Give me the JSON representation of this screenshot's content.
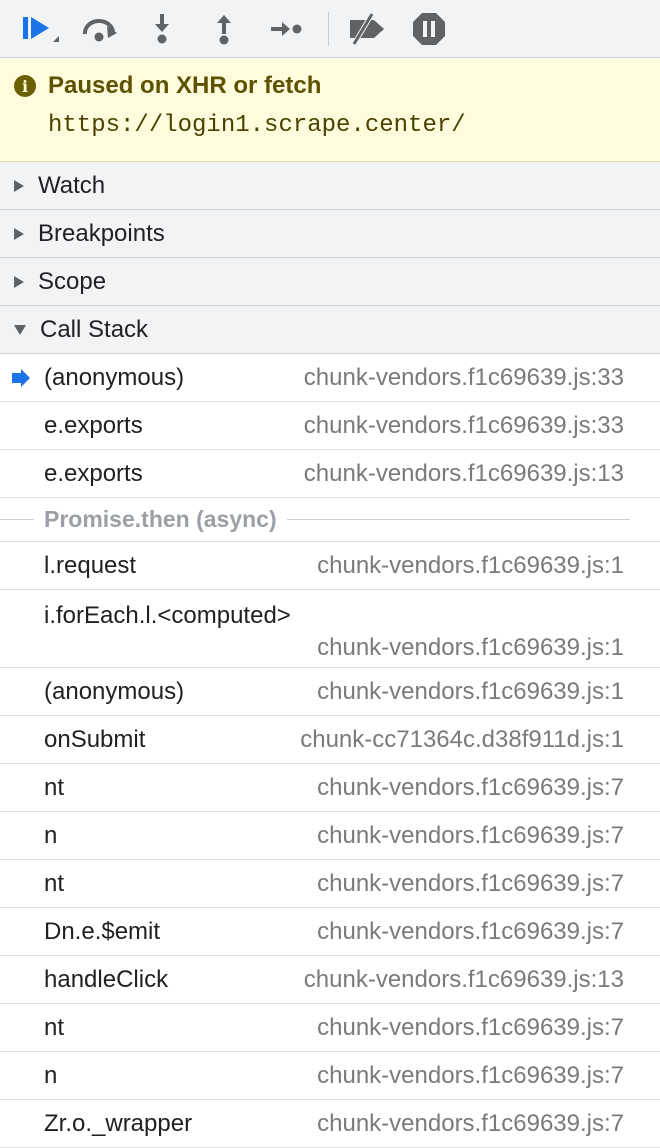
{
  "toolbar": {
    "icons": [
      "resume-icon",
      "step-over-icon",
      "step-into-icon",
      "step-out-icon",
      "step-icon",
      "deactivate-breakpoints-icon",
      "pause-on-exceptions-icon"
    ]
  },
  "banner": {
    "title": "Paused on XHR or fetch",
    "url": "https://login1.scrape.center/"
  },
  "sections": {
    "watch": "Watch",
    "breakpoints": "Breakpoints",
    "scope": "Scope",
    "call_stack": "Call Stack"
  },
  "call_stack": {
    "frames_top": [
      {
        "fn": "(anonymous)",
        "loc": "chunk-vendors.f1c69639.js:33",
        "current": true
      },
      {
        "fn": "e.exports",
        "loc": "chunk-vendors.f1c69639.js:33"
      },
      {
        "fn": "e.exports",
        "loc": "chunk-vendors.f1c69639.js:13"
      }
    ],
    "async_label": "Promise.then (async)",
    "frames_bottom": [
      {
        "fn": "l.request",
        "loc": "chunk-vendors.f1c69639.js:1"
      },
      {
        "fn": "i.forEach.l.<computed>",
        "loc": "chunk-vendors.f1c69639.js:1"
      },
      {
        "fn": "(anonymous)",
        "loc": "chunk-vendors.f1c69639.js:1"
      },
      {
        "fn": "onSubmit",
        "loc": "chunk-cc71364c.d38f911d.js:1"
      },
      {
        "fn": "nt",
        "loc": "chunk-vendors.f1c69639.js:7"
      },
      {
        "fn": "n",
        "loc": "chunk-vendors.f1c69639.js:7"
      },
      {
        "fn": "nt",
        "loc": "chunk-vendors.f1c69639.js:7"
      },
      {
        "fn": "Dn.e.$emit",
        "loc": "chunk-vendors.f1c69639.js:7"
      },
      {
        "fn": "handleClick",
        "loc": "chunk-vendors.f1c69639.js:13"
      },
      {
        "fn": "nt",
        "loc": "chunk-vendors.f1c69639.js:7"
      },
      {
        "fn": "n",
        "loc": "chunk-vendors.f1c69639.js:7"
      },
      {
        "fn": "Zr.o._wrapper",
        "loc": "chunk-vendors.f1c69639.js:7"
      }
    ]
  },
  "colors": {
    "accent": "#1a73e8",
    "banner_bg": "#fffbdd",
    "banner_text": "#5c5200",
    "muted": "#7a7a7a"
  }
}
